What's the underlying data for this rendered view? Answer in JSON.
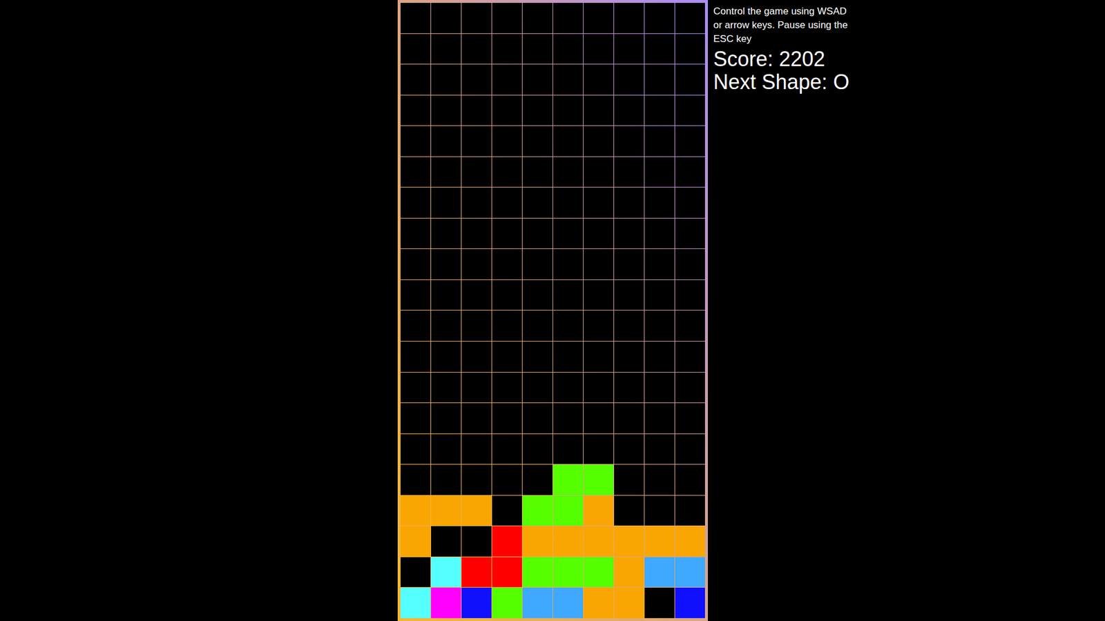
{
  "help": "Control the game using WSAD or arrow keys. Pause using the ESC key",
  "score": "Score: 2202",
  "next_shape": "Next Shape: O",
  "board": {
    "rows": [
      [
        null,
        null,
        null,
        null,
        null,
        null,
        null,
        null,
        null,
        null
      ],
      [
        null,
        null,
        null,
        null,
        null,
        null,
        null,
        null,
        null,
        null
      ],
      [
        null,
        null,
        null,
        null,
        null,
        null,
        null,
        null,
        null,
        null
      ],
      [
        null,
        null,
        null,
        null,
        null,
        null,
        null,
        null,
        null,
        null
      ],
      [
        null,
        null,
        null,
        null,
        null,
        null,
        null,
        null,
        null,
        null
      ],
      [
        null,
        null,
        null,
        null,
        null,
        null,
        null,
        null,
        null,
        null
      ],
      [
        null,
        null,
        null,
        null,
        null,
        null,
        null,
        null,
        null,
        null
      ],
      [
        null,
        null,
        null,
        null,
        null,
        null,
        null,
        null,
        null,
        null
      ],
      [
        null,
        null,
        null,
        null,
        null,
        null,
        null,
        null,
        null,
        null
      ],
      [
        null,
        null,
        null,
        null,
        null,
        null,
        null,
        null,
        null,
        null
      ],
      [
        null,
        null,
        null,
        null,
        null,
        null,
        null,
        null,
        null,
        null
      ],
      [
        null,
        null,
        null,
        null,
        null,
        null,
        null,
        null,
        null,
        null
      ],
      [
        null,
        null,
        null,
        null,
        null,
        null,
        null,
        null,
        null,
        null
      ],
      [
        null,
        null,
        null,
        null,
        null,
        null,
        null,
        null,
        null,
        null
      ],
      [
        null,
        null,
        null,
        null,
        null,
        null,
        null,
        null,
        null,
        null
      ],
      [
        null,
        null,
        null,
        null,
        null,
        "#55ff00",
        "#55ff00",
        null,
        null,
        null
      ],
      [
        "#f9a602",
        "#f9a602",
        "#f9a602",
        null,
        "#55ff00",
        "#55ff00",
        "#f9a602",
        null,
        null,
        null
      ],
      [
        "#f9a602",
        null,
        null,
        "#ff0000",
        "#f9a602",
        "#f9a602",
        "#f9a602",
        "#f9a602",
        "#f9a602",
        "#f9a602"
      ],
      [
        null,
        "#55ffff",
        "#ff0000",
        "#ff0000",
        "#55ff00",
        "#55ff00",
        "#55ff00",
        "#f9a602",
        "#3fa9ff",
        "#3fa9ff"
      ],
      [
        "#55ffff",
        "#ff00ff",
        "#1010ff",
        "#55ff00",
        "#3fa9ff",
        "#3fa9ff",
        "#f9a602",
        "#f9a602",
        null,
        "#1010ff"
      ]
    ]
  }
}
